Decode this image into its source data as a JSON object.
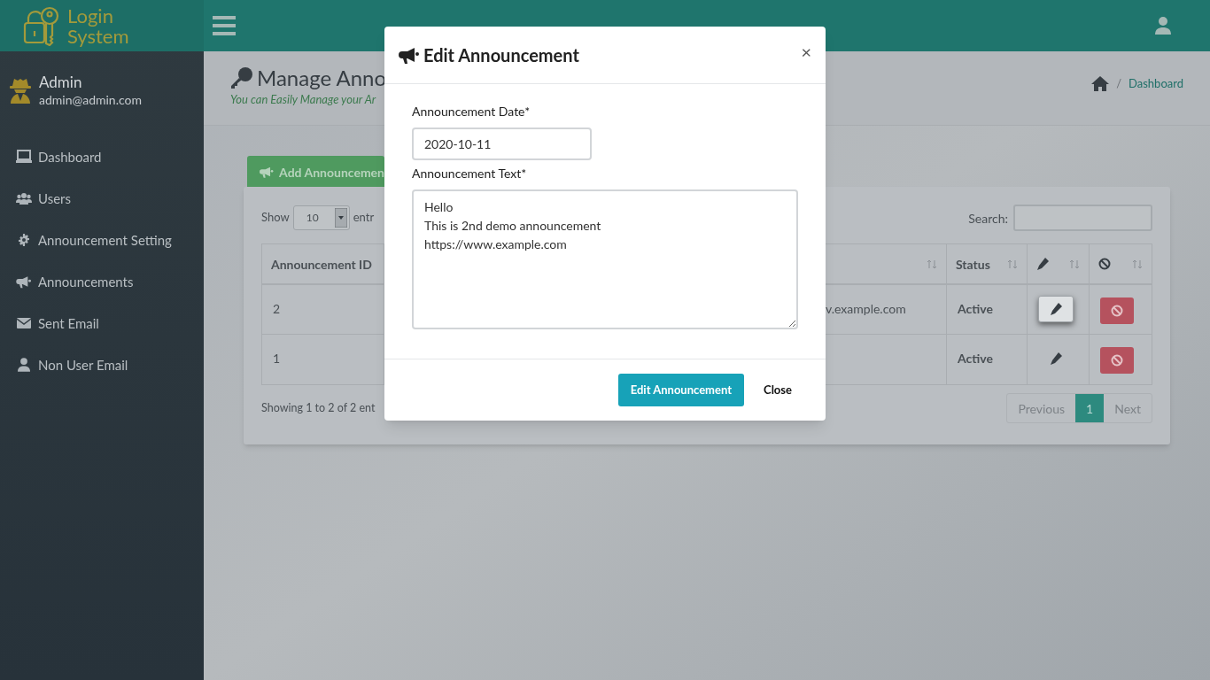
{
  "brand": {
    "line1": "Login",
    "line2": "System"
  },
  "user": {
    "name": "Admin",
    "email": "admin@admin.com"
  },
  "sidebar": {
    "items": [
      {
        "label": "Dashboard",
        "kind": "laptop"
      },
      {
        "label": "Users",
        "kind": "users"
      },
      {
        "label": "Announcement Setting",
        "kind": "gear"
      },
      {
        "label": "Announcements",
        "kind": "megaphone"
      },
      {
        "label": "Sent Email",
        "kind": "envelope"
      },
      {
        "label": "Non User Email",
        "kind": "user"
      }
    ]
  },
  "page": {
    "title": "Manage Anno",
    "subtitle": "You can Easily Manage your Ar",
    "breadcrumb_separator": "/",
    "breadcrumb": "Dashboard"
  },
  "add_button": "Add Announcemen",
  "table_controls": {
    "show_label": "Show",
    "page_size": "10",
    "entries_label": "entr",
    "search_label": "Search:"
  },
  "table": {
    "columns": [
      {
        "kind": "text",
        "label": "Announcement ID"
      },
      {
        "kind": "covered"
      },
      {
        "kind": "sort"
      },
      {
        "kind": "text",
        "label": "Status"
      },
      {
        "kind": "edit"
      },
      {
        "kind": "block"
      }
    ],
    "rows": [
      {
        "id": "2",
        "text": "v.example.com",
        "status": "Active",
        "focused": true
      },
      {
        "id": "1",
        "status": "Active",
        "focused": false
      }
    ]
  },
  "footer": {
    "info": "Showing 1 to 2 of 2 ent",
    "pages": [
      {
        "label": "Previous",
        "selected": false
      },
      {
        "label": "1",
        "selected": true
      },
      {
        "label": "Next",
        "selected": false
      }
    ]
  },
  "modal": {
    "title": "Edit Announcement",
    "close": "×",
    "date_label": "Announcement Date*",
    "date_value": "2020-10-11",
    "text_label": "Announcement Text*",
    "text_value": "Hello\nThis is 2nd demo announcement\nhttps://www.example.com",
    "buttons": [
      {
        "label": "Edit Announcement",
        "kind": "primary"
      },
      {
        "label": "Close",
        "kind": "plain"
      }
    ]
  }
}
